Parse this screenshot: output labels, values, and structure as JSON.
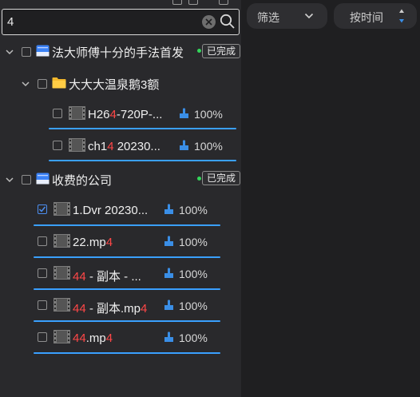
{
  "search": {
    "value": "4"
  },
  "tree": {
    "group1": {
      "title": "法大师傅十分的手法首发",
      "status": "已完成",
      "folder": {
        "title": "大大大温泉鹅3额",
        "files": [
          {
            "parts": [
              "H26",
              "4",
              "-720P-..."
            ],
            "progress": "100%"
          },
          {
            "parts": [
              "ch1",
              "4",
              " 20230..."
            ],
            "progress": "100%"
          }
        ]
      }
    },
    "group2": {
      "title": "收费的公司",
      "status": "已完成",
      "files": [
        {
          "parts": [
            "1.Dvr  20230..."
          ],
          "progress": "100%",
          "checked": true
        },
        {
          "parts": [
            "22.mp",
            "4"
          ],
          "progress": "100%"
        },
        {
          "parts": [
            "44",
            " - 副本 - ..."
          ],
          "progress": "100%"
        },
        {
          "parts": [
            "44",
            " - 副本.mp",
            "4"
          ],
          "progress": "100%"
        },
        {
          "parts": [
            "44",
            ".mp",
            "4"
          ],
          "progress": "100%"
        }
      ]
    }
  },
  "toolbar": {
    "filter_label": "筛选",
    "sort_label": "按时间"
  },
  "colors": {
    "accent": "#3aa0ff",
    "highlight": "#ff4747",
    "done_dot": "#33d65a"
  }
}
